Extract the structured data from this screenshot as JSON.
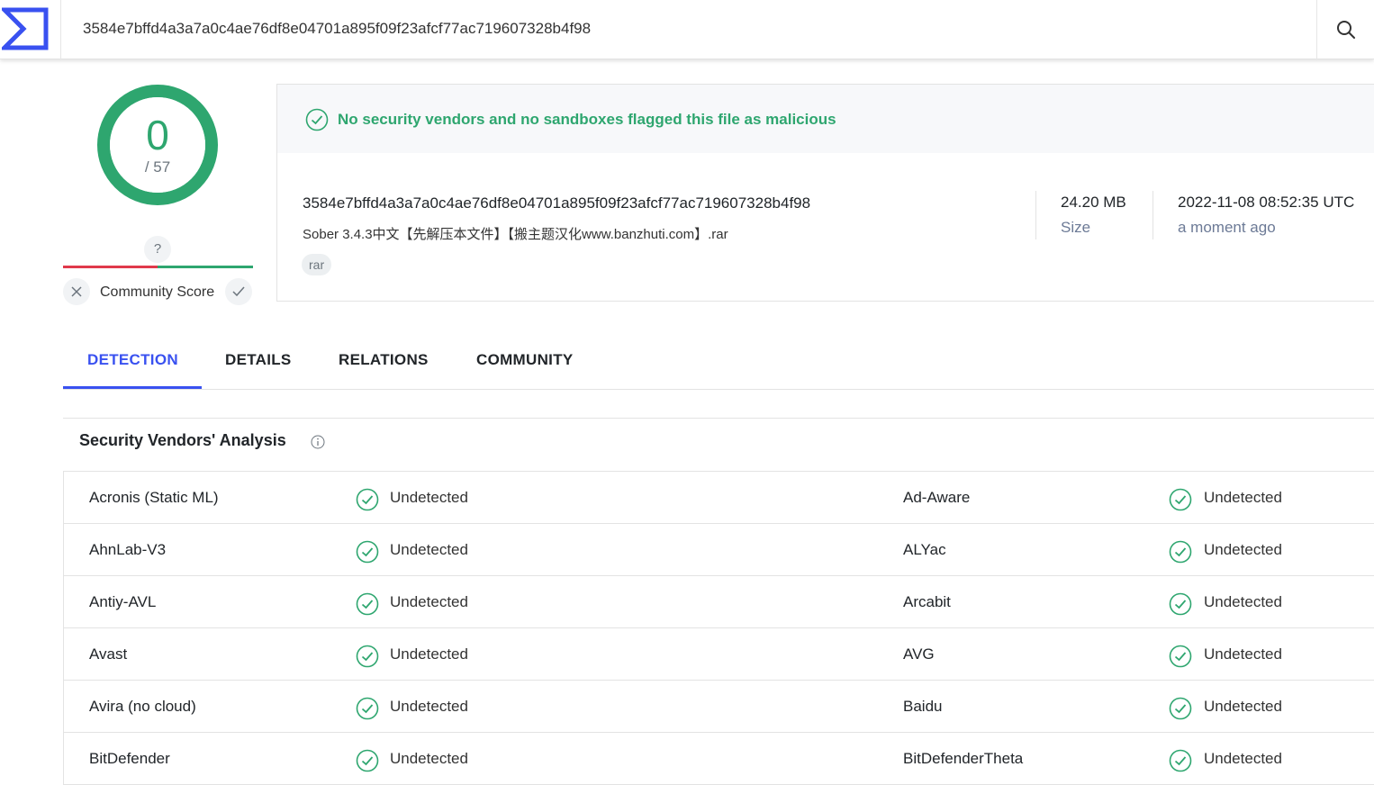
{
  "search": {
    "value": "3584e7bffd4a3a7a0c4ae76df8e04701a895f09f23afcf77ac719607328b4f98"
  },
  "score": {
    "detections": "0",
    "total": "/ 57",
    "community_unknown": "?",
    "community_label": "Community Score"
  },
  "summary": {
    "verdict": "No security vendors and no sandboxes flagged this file as malicious",
    "hash": "3584e7bffd4a3a7a0c4ae76df8e04701a895f09f23afcf77ac719607328b4f98",
    "filename": "Sober 3.4.3中文【先解压本文件】【搬主题汉化www.banzhuti.com】.rar",
    "tag": "rar",
    "size_value": "24.20 MB",
    "size_label": "Size",
    "date_value": "2022-11-08 08:52:35 UTC",
    "date_relative": "a moment ago"
  },
  "tabs": [
    "DETECTION",
    "DETAILS",
    "RELATIONS",
    "COMMUNITY"
  ],
  "vendors": {
    "title": "Security Vendors' Analysis",
    "rows": [
      [
        {
          "vendor": "Acronis (Static ML)",
          "result": "Undetected"
        },
        {
          "vendor": "Ad-Aware",
          "result": "Undetected"
        }
      ],
      [
        {
          "vendor": "AhnLab-V3",
          "result": "Undetected"
        },
        {
          "vendor": "ALYac",
          "result": "Undetected"
        }
      ],
      [
        {
          "vendor": "Antiy-AVL",
          "result": "Undetected"
        },
        {
          "vendor": "Arcabit",
          "result": "Undetected"
        }
      ],
      [
        {
          "vendor": "Avast",
          "result": "Undetected"
        },
        {
          "vendor": "AVG",
          "result": "Undetected"
        }
      ],
      [
        {
          "vendor": "Avira (no cloud)",
          "result": "Undetected"
        },
        {
          "vendor": "Baidu",
          "result": "Undetected"
        }
      ],
      [
        {
          "vendor": "BitDefender",
          "result": "Undetected"
        },
        {
          "vendor": "BitDefenderTheta",
          "result": "Undetected"
        }
      ]
    ]
  },
  "colors": {
    "accent": "#3951f0",
    "clean": "#2ea66f",
    "malicious": "#e0394b"
  }
}
